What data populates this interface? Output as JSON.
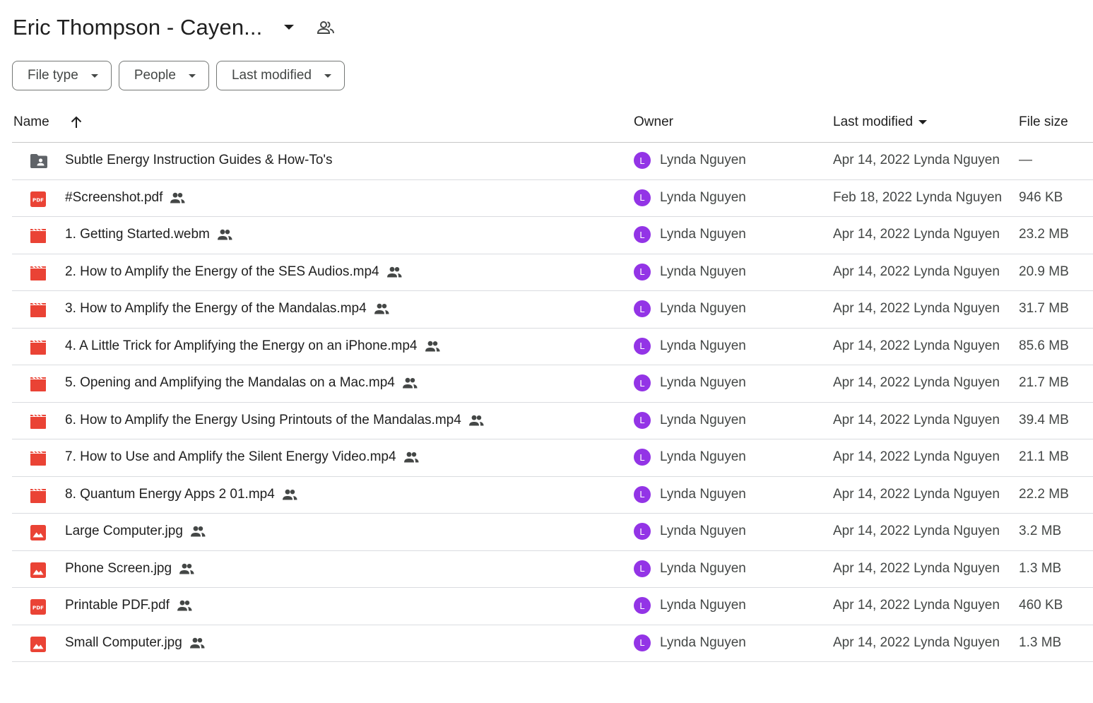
{
  "header": {
    "title": "Eric Thompson - Cayen...",
    "dropdown_icon": "arrow-drop-down-icon",
    "shared_icon": "shared-people-icon"
  },
  "filters": [
    {
      "label": "File type"
    },
    {
      "label": "People"
    },
    {
      "label": "Last modified"
    }
  ],
  "columns": {
    "name": "Name",
    "owner": "Owner",
    "last_modified": "Last modified",
    "file_size": "File size"
  },
  "colors": {
    "avatar": "#9334e6",
    "file_red": "#ea4335",
    "folder_gray": "#5f6368"
  },
  "files": [
    {
      "name": "Subtle Energy Instruction Guides & How-To's",
      "type": "shared-folder",
      "shared": false,
      "owner_initial": "L",
      "owner": "Lynda Nguyen",
      "modified": "Apr 14, 2022 Lynda Nguyen",
      "size": "—"
    },
    {
      "name": "#Screenshot.pdf",
      "type": "pdf",
      "shared": true,
      "owner_initial": "L",
      "owner": "Lynda Nguyen",
      "modified": "Feb 18, 2022 Lynda Nguyen",
      "size": "946 KB"
    },
    {
      "name": "1. Getting Started.webm",
      "type": "video",
      "shared": true,
      "owner_initial": "L",
      "owner": "Lynda Nguyen",
      "modified": "Apr 14, 2022 Lynda Nguyen",
      "size": "23.2 MB"
    },
    {
      "name": "2. How to Amplify the Energy of the SES Audios.mp4",
      "type": "video",
      "shared": true,
      "owner_initial": "L",
      "owner": "Lynda Nguyen",
      "modified": "Apr 14, 2022 Lynda Nguyen",
      "size": "20.9 MB"
    },
    {
      "name": "3. How to Amplify the Energy of the Mandalas.mp4",
      "type": "video",
      "shared": true,
      "owner_initial": "L",
      "owner": "Lynda Nguyen",
      "modified": "Apr 14, 2022 Lynda Nguyen",
      "size": "31.7 MB"
    },
    {
      "name": "4. A Little Trick for Amplifying the Energy on an iPhone.mp4",
      "type": "video",
      "shared": true,
      "owner_initial": "L",
      "owner": "Lynda Nguyen",
      "modified": "Apr 14, 2022 Lynda Nguyen",
      "size": "85.6 MB"
    },
    {
      "name": "5. Opening and Amplifying the Mandalas on a Mac.mp4",
      "type": "video",
      "shared": true,
      "owner_initial": "L",
      "owner": "Lynda Nguyen",
      "modified": "Apr 14, 2022 Lynda Nguyen",
      "size": "21.7 MB"
    },
    {
      "name": "6. How to Amplify the Energy Using Printouts of the Mandalas.mp4",
      "type": "video",
      "shared": true,
      "owner_initial": "L",
      "owner": "Lynda Nguyen",
      "modified": "Apr 14, 2022 Lynda Nguyen",
      "size": "39.4 MB"
    },
    {
      "name": "7. How to Use and Amplify the Silent Energy Video.mp4",
      "type": "video",
      "shared": true,
      "owner_initial": "L",
      "owner": "Lynda Nguyen",
      "modified": "Apr 14, 2022 Lynda Nguyen",
      "size": "21.1 MB"
    },
    {
      "name": "8. Quantum Energy Apps 2 01.mp4",
      "type": "video",
      "shared": true,
      "owner_initial": "L",
      "owner": "Lynda Nguyen",
      "modified": "Apr 14, 2022 Lynda Nguyen",
      "size": "22.2 MB"
    },
    {
      "name": "Large Computer.jpg",
      "type": "image",
      "shared": true,
      "owner_initial": "L",
      "owner": "Lynda Nguyen",
      "modified": "Apr 14, 2022 Lynda Nguyen",
      "size": "3.2 MB"
    },
    {
      "name": "Phone Screen.jpg",
      "type": "image",
      "shared": true,
      "owner_initial": "L",
      "owner": "Lynda Nguyen",
      "modified": "Apr 14, 2022 Lynda Nguyen",
      "size": "1.3 MB"
    },
    {
      "name": "Printable PDF.pdf",
      "type": "pdf",
      "shared": true,
      "owner_initial": "L",
      "owner": "Lynda Nguyen",
      "modified": "Apr 14, 2022 Lynda Nguyen",
      "size": "460 KB"
    },
    {
      "name": "Small Computer.jpg",
      "type": "image",
      "shared": true,
      "owner_initial": "L",
      "owner": "Lynda Nguyen",
      "modified": "Apr 14, 2022 Lynda Nguyen",
      "size": "1.3 MB"
    }
  ]
}
